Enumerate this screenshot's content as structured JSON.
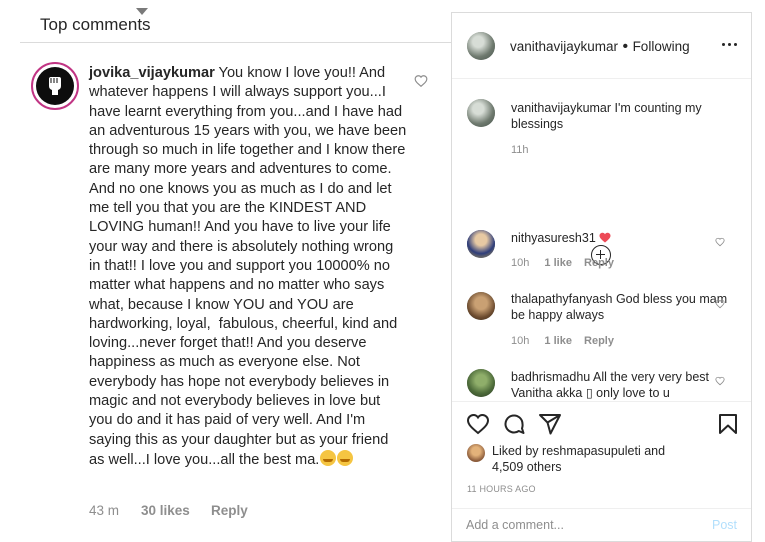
{
  "comments_panel": {
    "sort_label": "Top comments",
    "comment": {
      "username": "jovika_vijaykumar",
      "text": "You know I love you!! And whatever happens I will always support you...I have learnt everything from you...and I have had an adventurous 15 years with you, we have been through so much in life together and I know there are many more years and adventures to come. And no one knows you as much as I do and let me tell you that you are the KINDEST AND LOVING human!! And you have to live your life your way and there is absolutely nothing wrong in that!! I love you and support you 10000% no matter what happens and no matter who says what, because I know YOU and YOU are hardworking, loyal,  fabulous, cheerful, kind and loving...never forget that!! And you deserve happiness as much as everyone else. Not everybody has hope not everybody believes in magic and not everybody believes in love but you do and it has paid of very well. And I'm saying this as your daughter but as your friend as well...I love you...all the best ma.",
      "time": "43 m",
      "likes": "30 likes",
      "reply": "Reply"
    }
  },
  "post": {
    "author": "vanithavijaykumar",
    "dot": "•",
    "follow_status": "Following",
    "caption": {
      "username": "vanithavijaykumar",
      "text": "I'm counting my blessings",
      "time": "11h"
    },
    "comments": [
      {
        "username": "nithyasuresh31",
        "text": "",
        "time": "10h",
        "likes": "1 like",
        "reply": "Reply"
      },
      {
        "username": "thalapathyfanyash",
        "text": "God bless you mam be happy always",
        "time": "10h",
        "likes": "1 like",
        "reply": "Reply"
      },
      {
        "username": "badhrismadhu",
        "text": "All the very very best Vanitha akka ▯ only love to u",
        "time": "",
        "likes": "",
        "reply": ""
      }
    ],
    "liked_by_prefix": "Liked by",
    "liked_by_user": "reshmapasupuleti",
    "liked_by_and": "and",
    "liked_count": "4,509 others",
    "post_time": "11 HOURS AGO",
    "add_comment_placeholder": "Add a comment...",
    "post_label": "Post"
  },
  "colors": {
    "text": "#262626",
    "muted": "#8e8e8e",
    "border": "#dbdbdb",
    "heart": "#ed4956",
    "post_disabled": "#b2dffc"
  }
}
